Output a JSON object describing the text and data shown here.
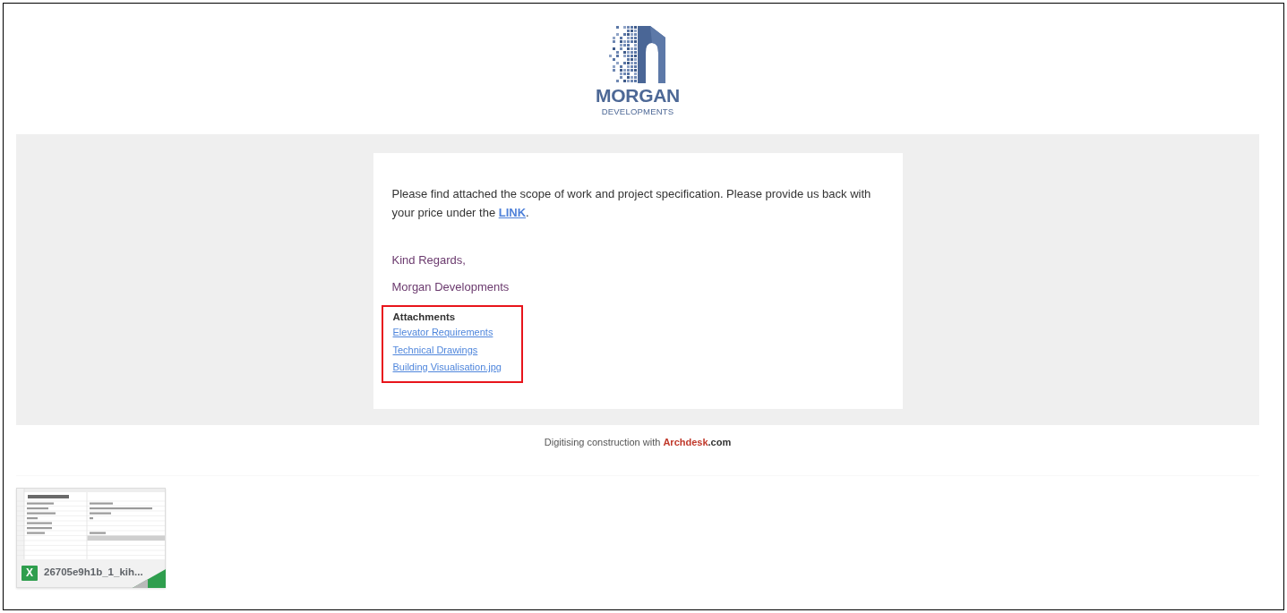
{
  "logo": {
    "name": "MORGAN",
    "tagline": "DEVELOPMENTS"
  },
  "message": {
    "text_before": "Please find attached the scope of work and project specification. Please provide us back with your price under the ",
    "link": "LINK",
    "text_after": "."
  },
  "closing": [
    "Kind Regards,",
    "Morgan Developments"
  ],
  "attachments": {
    "heading": "Attachments",
    "files": [
      "Elevator Requirements",
      "Technical Drawings",
      "Building Visualisation.jpg"
    ]
  },
  "footer": {
    "text": "Digitising construction with ",
    "brand": "Archdesk",
    "domain": ".com"
  },
  "attached_file": {
    "kind": "spreadsheet",
    "icon_letter": "X",
    "name": "26705e9h1b_1_kih..."
  }
}
